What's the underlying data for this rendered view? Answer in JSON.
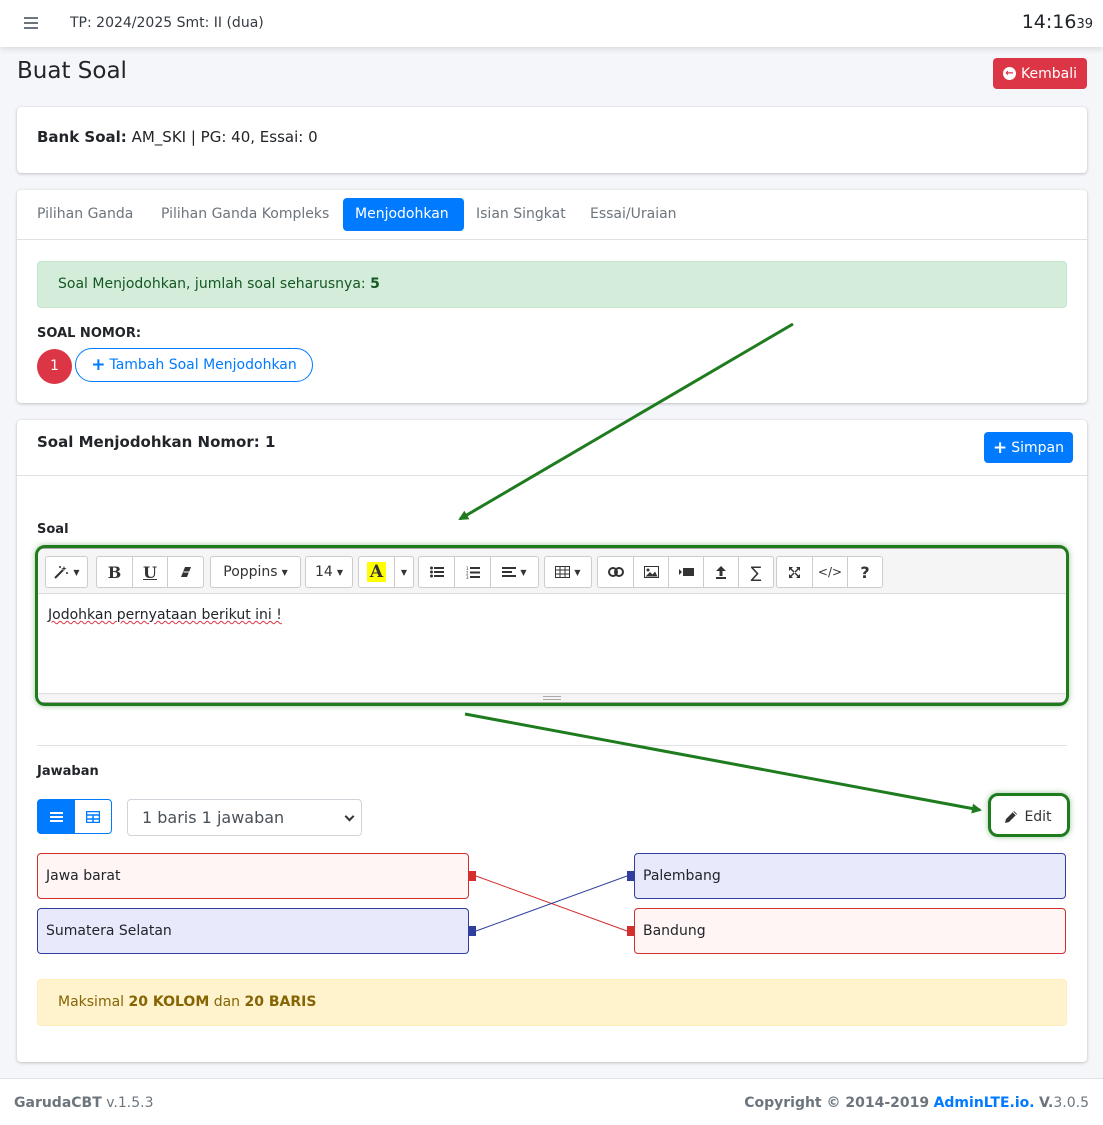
{
  "header": {
    "tp_text": "TP: 2024/2025 Smt: II (dua)",
    "clock_hm": "14:16",
    "clock_sec": "39"
  },
  "page": {
    "title": "Buat Soal",
    "back_button": "Kembali"
  },
  "bank": {
    "label": "Bank Soal:",
    "value": "AM_SKI | PG: 40, Essai: 0"
  },
  "tabs": [
    {
      "label": "Pilihan Ganda",
      "active": false
    },
    {
      "label": "Pilihan Ganda Kompleks",
      "active": false
    },
    {
      "label": "Menjodohkan",
      "active": true
    },
    {
      "label": "Isian Singkat",
      "active": false
    },
    {
      "label": "Essai/Uraian",
      "active": false
    }
  ],
  "info_alert": {
    "text": "Soal Menjodohkan, jumlah soal seharusnya:",
    "count": "5"
  },
  "soal_nomor": {
    "label": "SOAL NOMOR:",
    "current": "1",
    "add_button": "Tambah Soal Menjodohkan"
  },
  "editor_card": {
    "title": "Soal Menjodohkan Nomor: 1",
    "save_button": "Simpan",
    "soal_label": "Soal",
    "toolbar": {
      "font_name": "Poppins",
      "font_size": "14"
    },
    "content": "Jodohkan pernyataan berikut ini !"
  },
  "jawaban": {
    "label": "Jawaban",
    "select_value": "1 baris 1 jawaban",
    "edit_button": "Edit",
    "left_items": [
      {
        "label": "Jawa barat",
        "color": "#d32f2f"
      },
      {
        "label": "Sumatera Selatan",
        "color": "#303f9f"
      }
    ],
    "right_items": [
      {
        "label": "Palembang",
        "color": "#303f9f"
      },
      {
        "label": "Bandung",
        "color": "#d32f2f"
      }
    ]
  },
  "warning_alert": {
    "prefix": "Maksimal",
    "cols": "20 KOLOM",
    "mid": "dan",
    "rows": "20 BARIS"
  },
  "footer": {
    "app_name": "GarudaCBT",
    "app_version": "v.1.5.3",
    "copyright": "Copyright © 2014-2019",
    "brand": "AdminLTE.io.",
    "version_label": "V.",
    "version": "3.0.5"
  },
  "colors": {
    "primary": "#007bff",
    "danger": "#dc3545",
    "annotation": "#1e7b1e"
  }
}
